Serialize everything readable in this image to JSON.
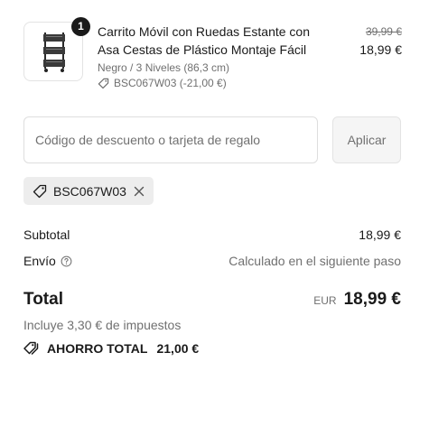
{
  "line_item": {
    "quantity": "1",
    "title_line1": "Carrito Móvil con Ruedas Estante con",
    "title_line2": "Asa Cestas de Plástico Montaje Fácil",
    "variant": "Negro / 3 Niveles (86,3 cm)",
    "discount_code": "BSC067W03 (-21,00 €)",
    "compare_at_price": "39,99 €",
    "price": "18,99 €"
  },
  "discount": {
    "placeholder": "Código de descuento o tarjeta de regalo",
    "value": "",
    "apply_label": "Aplicar",
    "applied_code": "BSC067W03"
  },
  "summary": {
    "subtotal_label": "Subtotal",
    "subtotal_value": "18,99 €",
    "shipping_label": "Envío",
    "shipping_value": "Calculado en el siguiente paso",
    "total_label": "Total",
    "currency": "EUR",
    "total_value": "18,99 €",
    "taxes_note": "Incluye 3,30 € de impuestos",
    "savings_label": "AHORRO TOTAL",
    "savings_value": "21,00 €"
  },
  "icons": {
    "product_image": "rolling-cart-image",
    "discount_tag": "tag-icon",
    "remove": "close-icon",
    "help": "question-circle-icon",
    "savings": "tags-icon"
  },
  "colors": {
    "text": "#1a1a1a",
    "muted": "#707070",
    "border": "#dedede",
    "chip_bg": "#ededed",
    "badge_bg": "#1a1a1a"
  }
}
